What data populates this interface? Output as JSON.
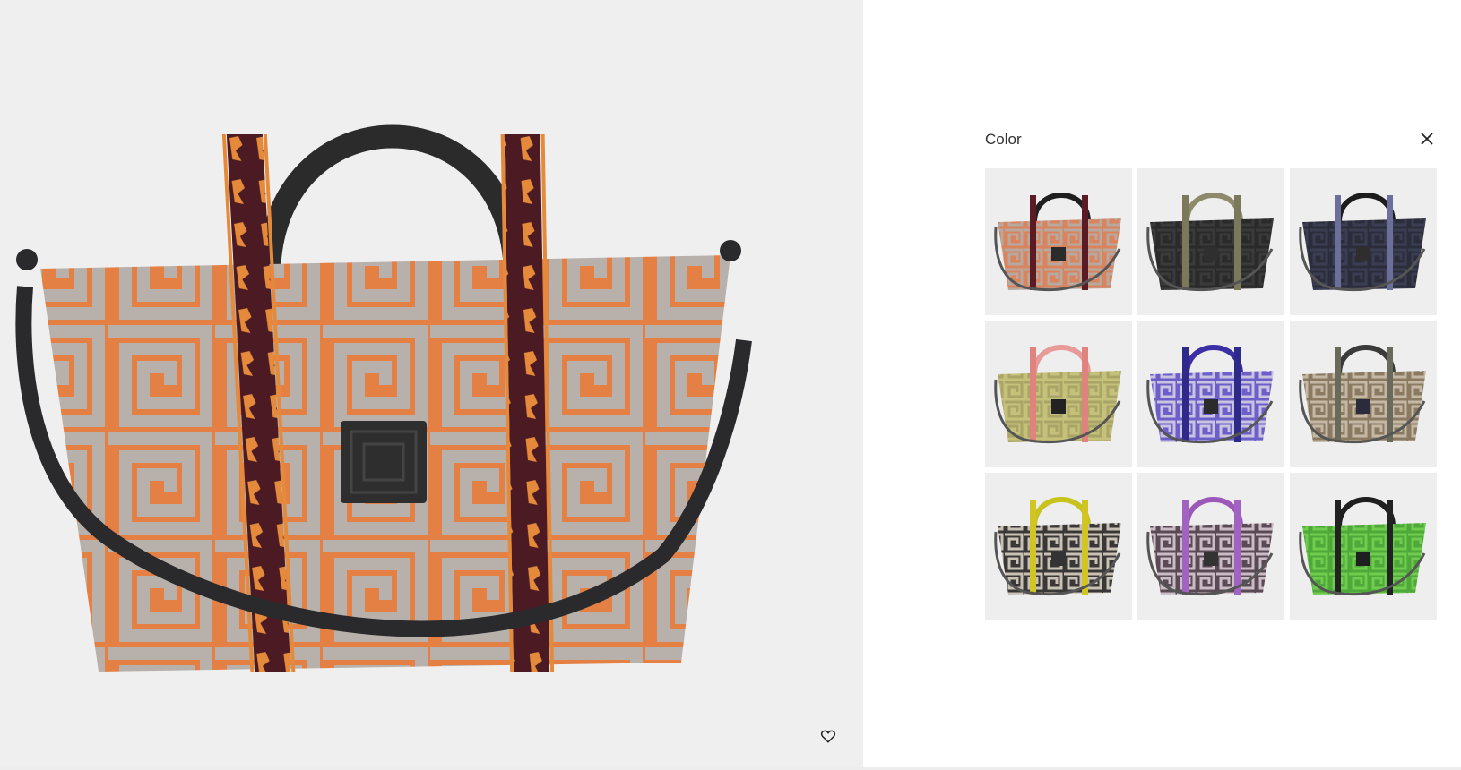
{
  "color_panel": {
    "title": "Color",
    "close_icon": "close-icon",
    "swatches": [
      {
        "name": "orange-grey",
        "body": "#d9845d",
        "pattern": "#b7a9a0",
        "handle": "#1f1f1f",
        "strap": "#5a1b24",
        "patch": "#2b2b2b"
      },
      {
        "name": "black-gold",
        "body": "#2a2a2a",
        "pattern": "#3a3a3a",
        "handle": "#8c8a6a",
        "strap": "#7a7a5a",
        "patch": "#2f2f2f"
      },
      {
        "name": "navy-black",
        "body": "#2b2d3b",
        "pattern": "#3b3e52",
        "handle": "#1c1c1c",
        "strap": "#6b6f9a",
        "patch": "#2e2e2e"
      },
      {
        "name": "olive-pink",
        "body": "#c5c07a",
        "pattern": "#a9a566",
        "handle": "#e79a97",
        "strap": "#e0837f",
        "patch": "#222222"
      },
      {
        "name": "purple-blue",
        "body": "#6c5fc9",
        "pattern": "#c9c3df",
        "handle": "#3c2ea5",
        "strap": "#2e2a8a",
        "patch": "#2b2b2b"
      },
      {
        "name": "taupe-brown",
        "body": "#8a7a62",
        "pattern": "#c4b8a5",
        "handle": "#3a3a3a",
        "strap": "#6a6a5a",
        "patch": "#2b2b3b"
      },
      {
        "name": "black-yellow",
        "body": "#3a3737",
        "pattern": "#c9c1b4",
        "handle": "#c7c21c",
        "strap": "#d1c524",
        "patch": "#333333"
      },
      {
        "name": "grey-violet",
        "body": "#5a4a55",
        "pattern": "#c9bcc4",
        "handle": "#9b58b8",
        "strap": "#a262c2",
        "patch": "#333333"
      },
      {
        "name": "green-black",
        "body": "#4fa83a",
        "pattern": "#6fcc4e",
        "handle": "#1f1f1f",
        "strap": "#222222",
        "patch": "#1f1f1f"
      }
    ]
  },
  "product_image": {
    "description_icon": "product-photo",
    "wishlist_icon": "heart-icon",
    "colors": {
      "body": "#e58045",
      "pattern": "#b7b0ab",
      "handle": "#2b2b2b",
      "strap": "#4b1a23",
      "strap_motif": "#e58a3a",
      "patch": "#2e2e2e",
      "shoulder_strap": "#2a2a2c"
    }
  }
}
